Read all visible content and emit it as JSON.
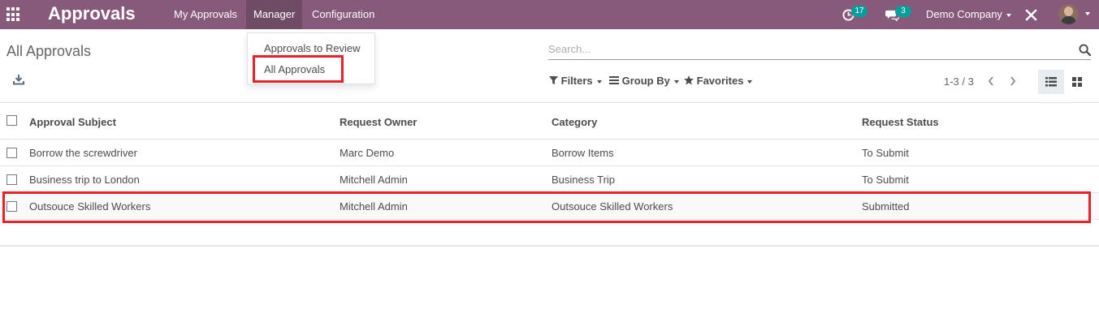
{
  "navbar": {
    "app_title": "Approvals",
    "menu": [
      "My Approvals",
      "Manager",
      "Configuration"
    ],
    "activity_count": "17",
    "message_count": "3",
    "company": "Demo Company"
  },
  "dropdown": {
    "items": [
      "Approvals to Review",
      "All Approvals"
    ]
  },
  "control_panel": {
    "breadcrumb": "All Approvals",
    "search_placeholder": "Search...",
    "filters_label": "Filters",
    "group_by_label": "Group By",
    "favorites_label": "Favorites",
    "pager": "1-3 / 3"
  },
  "table": {
    "columns": [
      "Approval Subject",
      "Request Owner",
      "Category",
      "Request Status"
    ],
    "rows": [
      [
        "Borrow the screwdriver",
        "Marc Demo",
        "Borrow Items",
        "To Submit"
      ],
      [
        "Business trip to London",
        "Mitchell Admin",
        "Business Trip",
        "To Submit"
      ],
      [
        "Outsouce Skilled Workers",
        "Mitchell Admin",
        "Outsouce Skilled Workers",
        "Submitted"
      ]
    ]
  },
  "colors": {
    "navbar": "#875a7b",
    "highlight": "#e8202a",
    "badge": "#00a09d"
  }
}
